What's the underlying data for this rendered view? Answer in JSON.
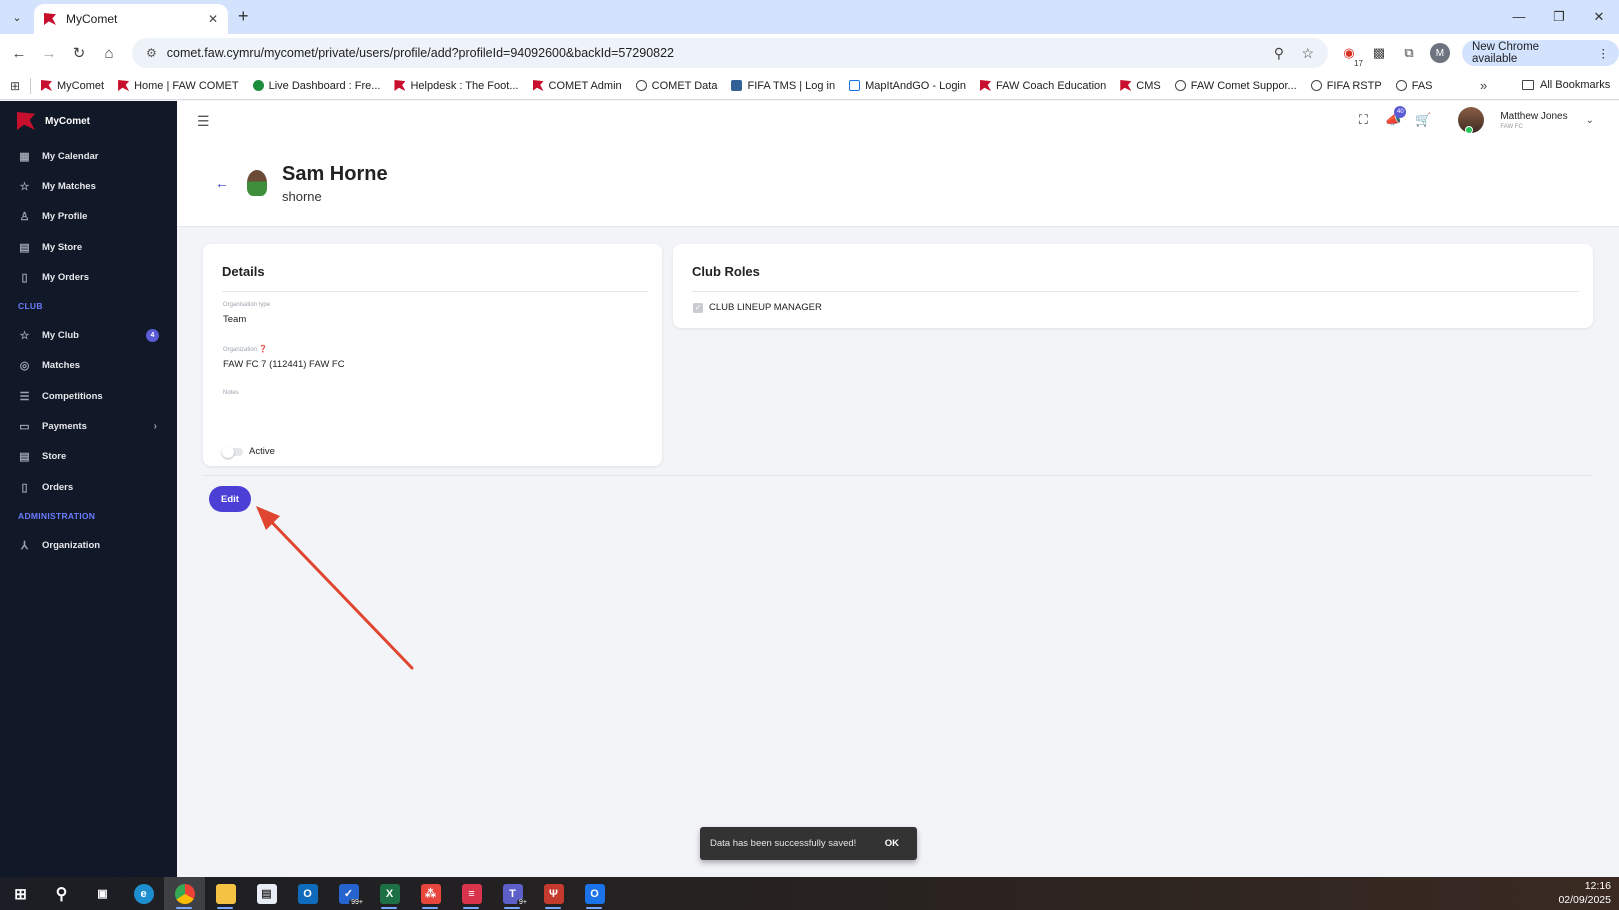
{
  "browser": {
    "tab_title": "MyComet",
    "url": "comet.faw.cymru/mycomet/private/users/profile/add?profileId=94092600&backId=57290822",
    "ext_badge": "17",
    "profile_initial": "M",
    "update_label": "New Chrome available",
    "bookmarks": [
      {
        "label": "MyComet",
        "icon": "dragon"
      },
      {
        "label": "Home | FAW COMET",
        "icon": "dragon"
      },
      {
        "label": "Live Dashboard : Fre...",
        "icon": "green"
      },
      {
        "label": "Helpdesk : The Foot...",
        "icon": "dragon"
      },
      {
        "label": "COMET Admin",
        "icon": "dragon"
      },
      {
        "label": "COMET Data",
        "icon": "globe"
      },
      {
        "label": "FIFA TMS | Log in",
        "icon": "fifa"
      },
      {
        "label": "MapItAndGO - Login",
        "icon": "map"
      },
      {
        "label": "FAW Coach Education",
        "icon": "dragon"
      },
      {
        "label": "CMS",
        "icon": "dragon"
      },
      {
        "label": "FAW Comet Suppor...",
        "icon": "globe"
      },
      {
        "label": "FIFA RSTP",
        "icon": "globe"
      },
      {
        "label": "FAS",
        "icon": "globe"
      }
    ],
    "all_bookmarks": "All Bookmarks"
  },
  "sidebar": {
    "brand": "MyComet",
    "items_top": [
      {
        "label": "My Calendar",
        "icon": "calendar-icon",
        "glyph": "▦"
      },
      {
        "label": "My Matches",
        "icon": "star-icon",
        "glyph": "☆"
      },
      {
        "label": "My Profile",
        "icon": "person-icon",
        "glyph": "♙"
      },
      {
        "label": "My Store",
        "icon": "store-icon",
        "glyph": "▤"
      },
      {
        "label": "My Orders",
        "icon": "receipt-icon",
        "glyph": "▯"
      }
    ],
    "section_club": "CLUB",
    "items_club": [
      {
        "label": "My Club",
        "icon": "star-icon",
        "glyph": "☆",
        "badge": "4"
      },
      {
        "label": "Matches",
        "icon": "soccer-ball-icon",
        "glyph": "◎"
      },
      {
        "label": "Competitions",
        "icon": "list-icon",
        "glyph": "☰"
      },
      {
        "label": "Payments",
        "icon": "credit-card-icon",
        "glyph": "▭",
        "chevron": "›"
      },
      {
        "label": "Store",
        "icon": "store-icon",
        "glyph": "▤"
      },
      {
        "label": "Orders",
        "icon": "receipt-icon",
        "glyph": "▯"
      }
    ],
    "section_admin": "ADMINISTRATION",
    "items_admin": [
      {
        "label": "Organization",
        "icon": "hierarchy-icon",
        "glyph": "⅄"
      }
    ]
  },
  "appbar": {
    "notifications_count": "40",
    "user_name": "Matthew Jones",
    "user_org": "FAW FC"
  },
  "profile": {
    "name": "Sam Horne",
    "username": "shorne"
  },
  "details": {
    "title": "Details",
    "org_type_label": "Organisation type",
    "org_type_value": "Team",
    "org_label": "Organization",
    "org_value": "FAW FC 7 (112441) FAW FC",
    "notes_label": "Notes",
    "notes_value": "",
    "active_label": "Active",
    "active": false
  },
  "club_roles": {
    "title": "Club Roles",
    "roles": [
      {
        "label": "CLUB LINEUP MANAGER",
        "checked": true
      }
    ]
  },
  "actions": {
    "edit_label": "Edit"
  },
  "snackbar": {
    "message": "Data has been successfully saved!",
    "ok_label": "OK"
  },
  "taskbar": {
    "time": "12:16",
    "date": "02/09/2025",
    "badges": {
      "todo": "99+",
      "teams": "9+"
    }
  },
  "colors": {
    "accent": "#4b3fd6",
    "sidebar_bg": "#111827",
    "annotation_arrow": "#e0452f"
  }
}
